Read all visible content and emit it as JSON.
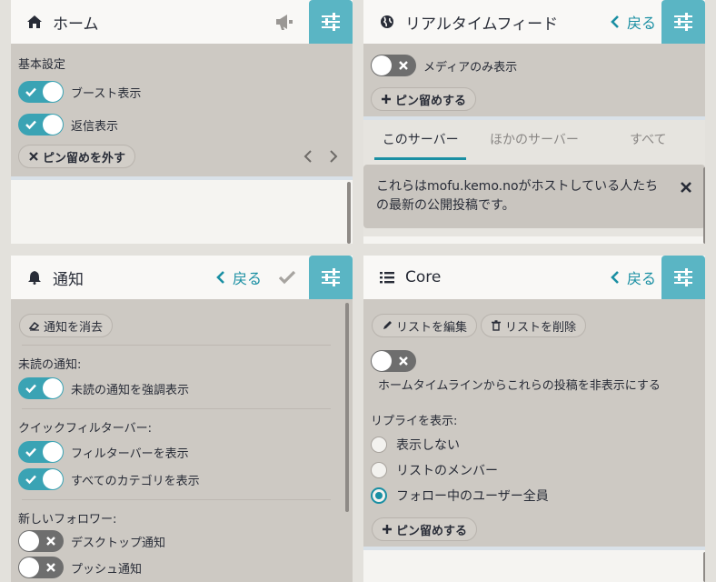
{
  "home": {
    "title": "ホーム",
    "basic_settings": "基本設定",
    "show_boosts": "ブースト表示",
    "show_replies": "返信表示",
    "unpin": "ピン留めを外す"
  },
  "realtime": {
    "title": "リアルタイムフィード",
    "back": "戻る",
    "media_only": "メディアのみ表示",
    "pin": "ピン留めする",
    "tabs": [
      "このサーバー",
      "ほかのサーバー",
      "すべて"
    ],
    "notice_line1": "これらはmofu.kemo.noがホストしている人たち",
    "notice_line2": "の最新の公開投稿です。"
  },
  "notifications": {
    "title": "通知",
    "back": "戻る",
    "clear": "通知を消去",
    "unread_label": "未読の通知:",
    "highlight_unread": "未読の通知を強調表示",
    "quick_filter_label": "クイックフィルターバー:",
    "show_filter_bar": "フィルターバーを表示",
    "show_all_categories": "すべてのカテゴリを表示",
    "new_followers_label": "新しいフォロワー:",
    "desktop_notifications": "デスクトップ通知",
    "push_notifications": "プッシュ通知"
  },
  "core": {
    "title": "Core",
    "back": "戻る",
    "edit_list": "リストを編集",
    "delete_list": "リストを削除",
    "hide_from_home": "ホームタイムラインからこれらの投稿を非表示にする",
    "show_replies_label": "リプライを表示:",
    "reply_options": [
      "表示しない",
      "リストのメンバー",
      "フォロー中のユーザー全員"
    ],
    "pin": "ピン留めする"
  },
  "colors": {
    "accent": "#1a8fa3",
    "toggle_on": "#3aa3b4",
    "settings_btn": "#5ab5c4"
  }
}
